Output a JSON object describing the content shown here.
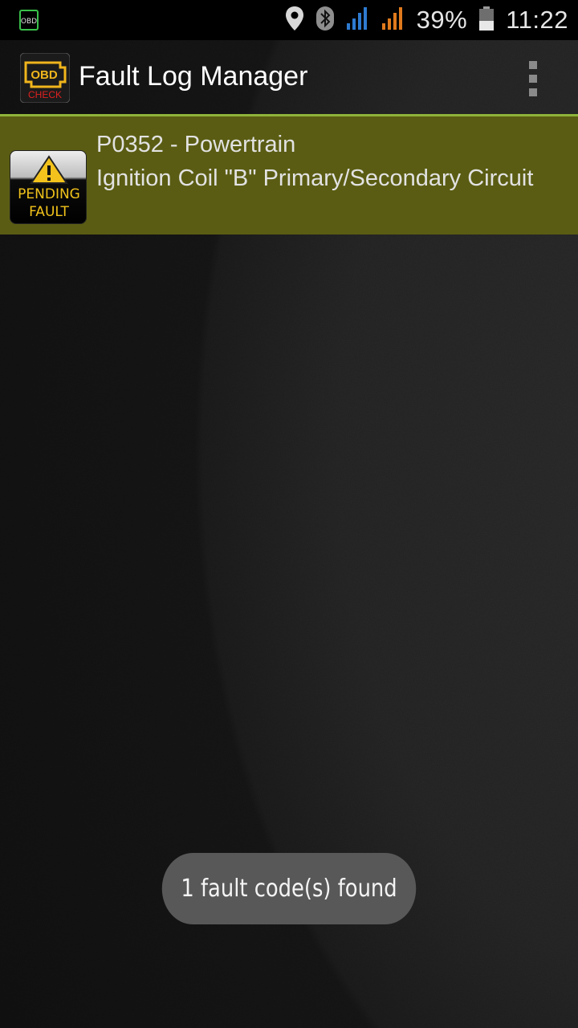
{
  "statusbar": {
    "obd_notification_label": "OBD",
    "battery": "39%",
    "time": "11:22"
  },
  "actionbar": {
    "icon_top_text": "OBD",
    "icon_bottom_text": "CHECK",
    "title": "Fault Log Manager"
  },
  "faults": [
    {
      "badge_line1": "PENDING",
      "badge_line2": "FAULT",
      "code": "P0352 - Powertrain",
      "description": "Ignition Coil \"B\" Primary/Secondary Circuit"
    }
  ],
  "toast": {
    "message": "1 fault code(s) found"
  },
  "colors": {
    "fault_row_bg": "#5a5c13",
    "divider": "#8fb33a",
    "badge_text": "#f1c21a"
  }
}
